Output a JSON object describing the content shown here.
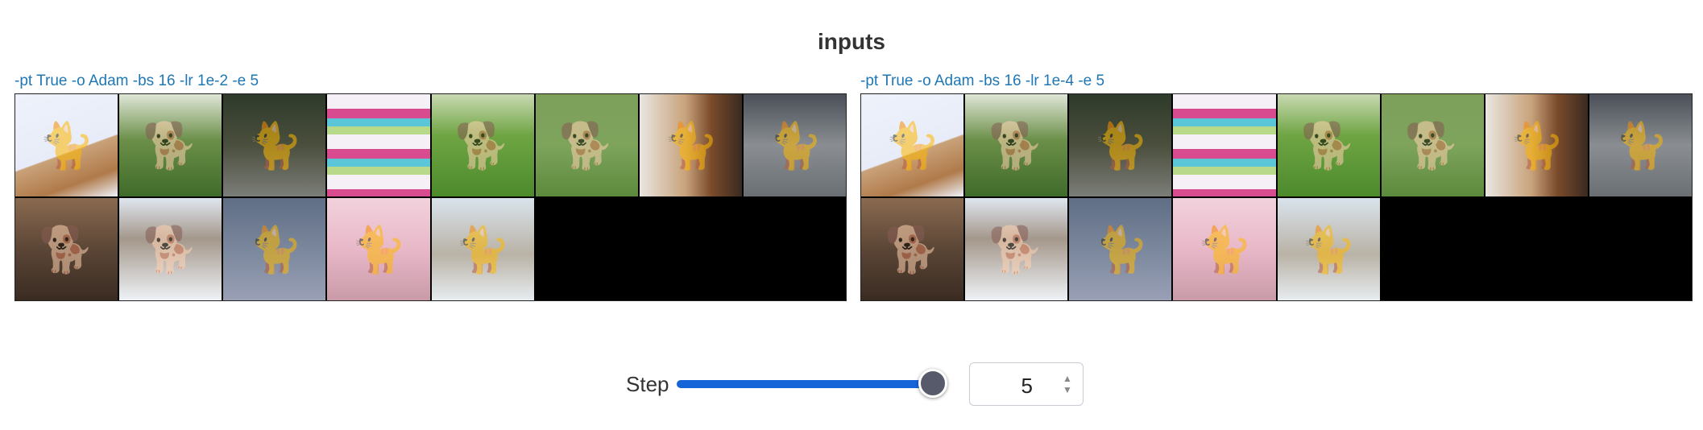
{
  "section": {
    "title": "inputs"
  },
  "panels": [
    {
      "label": "-pt True -o Adam -bs 16 -lr 1e-2 -e 5",
      "tiles": [
        {
          "icon": "cat-icon"
        },
        {
          "icon": "dog-icon"
        },
        {
          "icon": "cat-icon"
        },
        {
          "icon": "poster-icon"
        },
        {
          "icon": "dog-icon"
        },
        {
          "icon": "dog-icon"
        },
        {
          "icon": "cat-icon"
        },
        {
          "icon": "cat-icon"
        },
        {
          "icon": "dog-icon"
        },
        {
          "icon": "dog-icon"
        },
        {
          "icon": "cat-icon"
        },
        {
          "icon": "cat-icon"
        },
        {
          "icon": "cat-icon"
        }
      ],
      "empty_slots": 3
    },
    {
      "label": "-pt True -o Adam -bs 16 -lr 1e-4 -e 5",
      "tiles": [
        {
          "icon": "cat-icon"
        },
        {
          "icon": "dog-icon"
        },
        {
          "icon": "cat-icon"
        },
        {
          "icon": "poster-icon"
        },
        {
          "icon": "dog-icon"
        },
        {
          "icon": "dog-icon"
        },
        {
          "icon": "cat-icon"
        },
        {
          "icon": "cat-icon"
        },
        {
          "icon": "dog-icon"
        },
        {
          "icon": "dog-icon"
        },
        {
          "icon": "cat-icon"
        },
        {
          "icon": "cat-icon"
        },
        {
          "icon": "cat-icon"
        }
      ],
      "empty_slots": 3
    }
  ],
  "step_control": {
    "label": "Step",
    "value": "5",
    "slider_fraction": 1.0,
    "colors": {
      "accent": "#1565d8",
      "thumb": "#575a6a",
      "label_link": "#1f77b4"
    }
  }
}
